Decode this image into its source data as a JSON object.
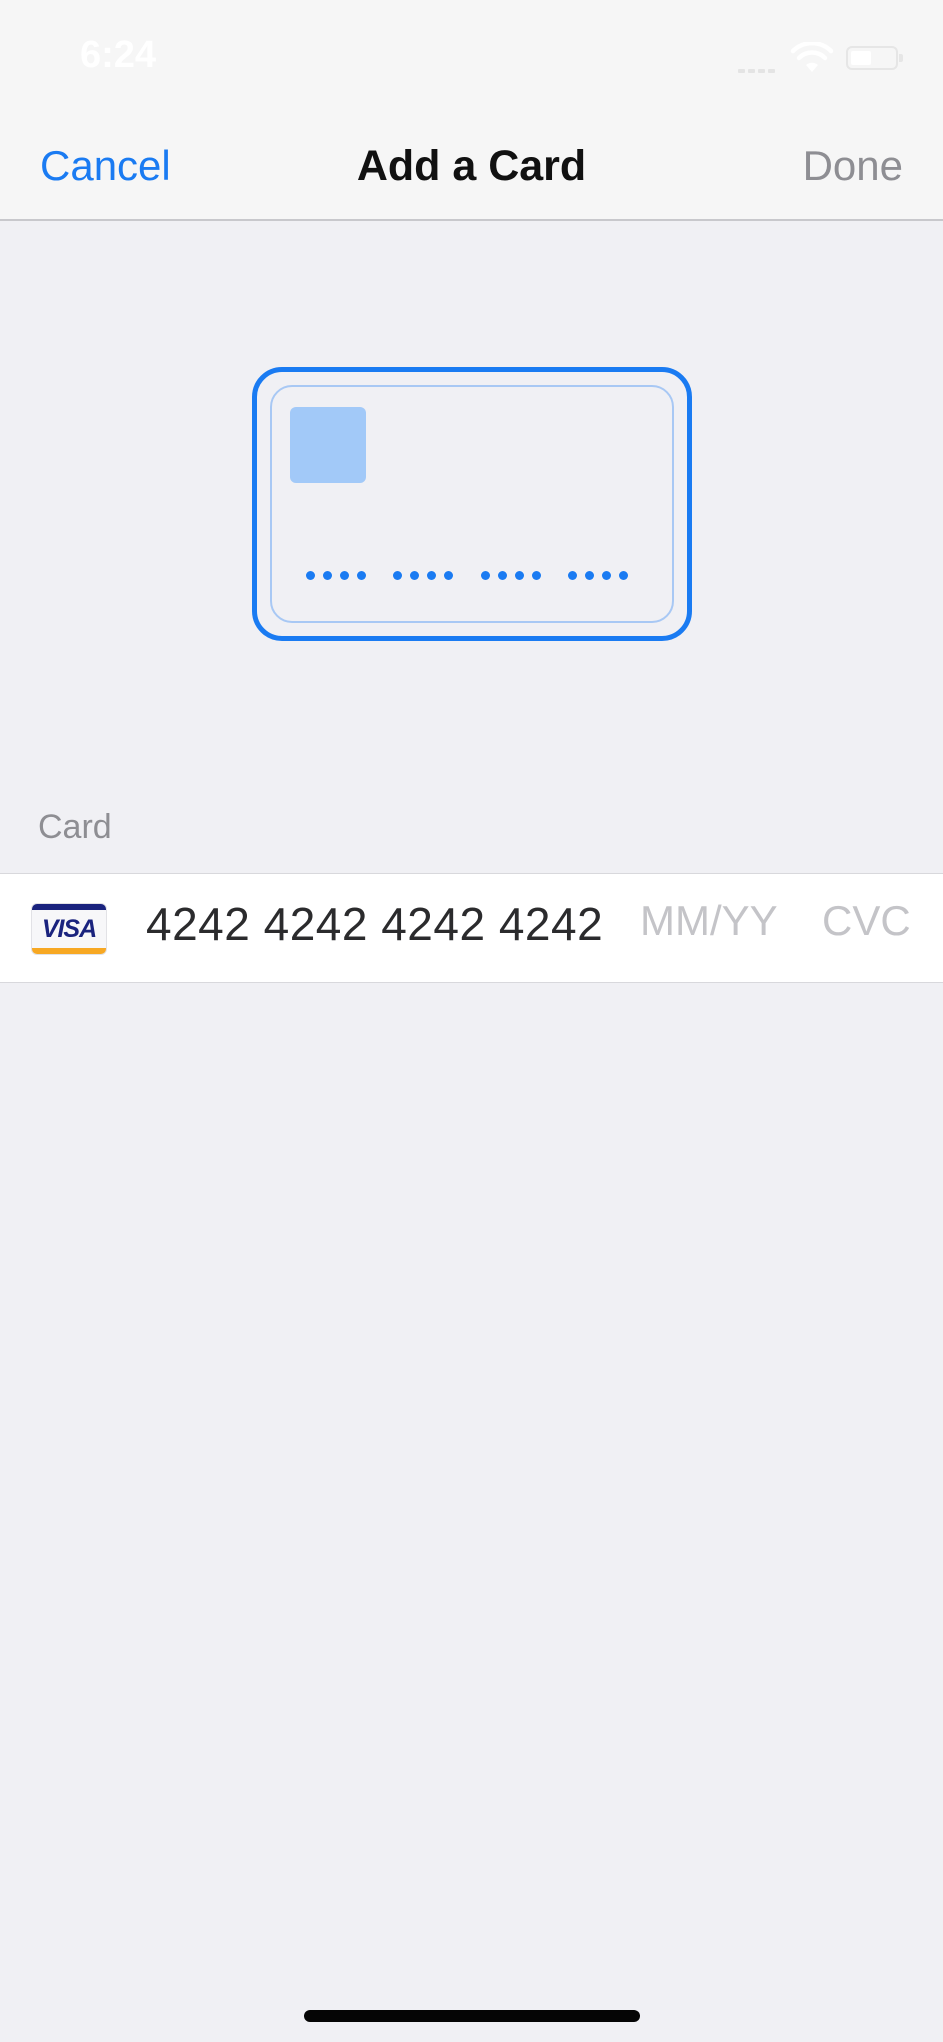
{
  "status_bar": {
    "time": "6:24",
    "icons": [
      "cellular-signal-icon",
      "wifi-icon",
      "battery-icon"
    ]
  },
  "nav": {
    "cancel_label": "Cancel",
    "title": "Add a Card",
    "done_label": "Done"
  },
  "card_illustration": {
    "icon": "credit-card-icon",
    "dot_groups": 4,
    "dots_per_group": 4
  },
  "form": {
    "section_label": "Card",
    "brand_icon": "visa-icon",
    "brand_label": "VISA",
    "card_number": "4242 4242 4242 4242",
    "expiry_placeholder": "MM/YY",
    "cvc_placeholder": "CVC"
  },
  "colors": {
    "accent": "#1a7bf2",
    "disabled": "#8e8e93",
    "background": "#f0f0f4",
    "placeholder": "#c4c4c8",
    "visa_blue": "#1a237e",
    "visa_gold": "#f7a823"
  }
}
